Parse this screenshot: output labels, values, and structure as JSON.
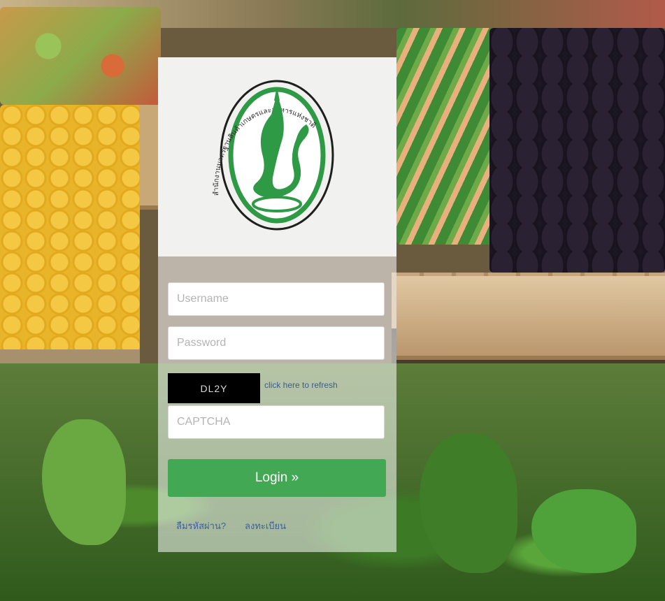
{
  "logo": {
    "name": "agency-seal",
    "ring_text": "สำนักงานมาตรฐานสินค้าเกษตรและอาหารแห่งชาติ",
    "color": "#2f9a45"
  },
  "form": {
    "username_placeholder": "Username",
    "password_placeholder": "Password",
    "captcha_code": "DL2Y",
    "refresh_label": "click here to refresh",
    "captcha_placeholder": "CAPTCHA",
    "login_label": "Login »"
  },
  "links": {
    "forgot_password": "ลืมรหัสผ่าน?",
    "register": "ลงทะเบียน"
  },
  "colors": {
    "login_button": "#43a854",
    "link": "#3d5f9a",
    "captcha_bg": "#000000"
  }
}
